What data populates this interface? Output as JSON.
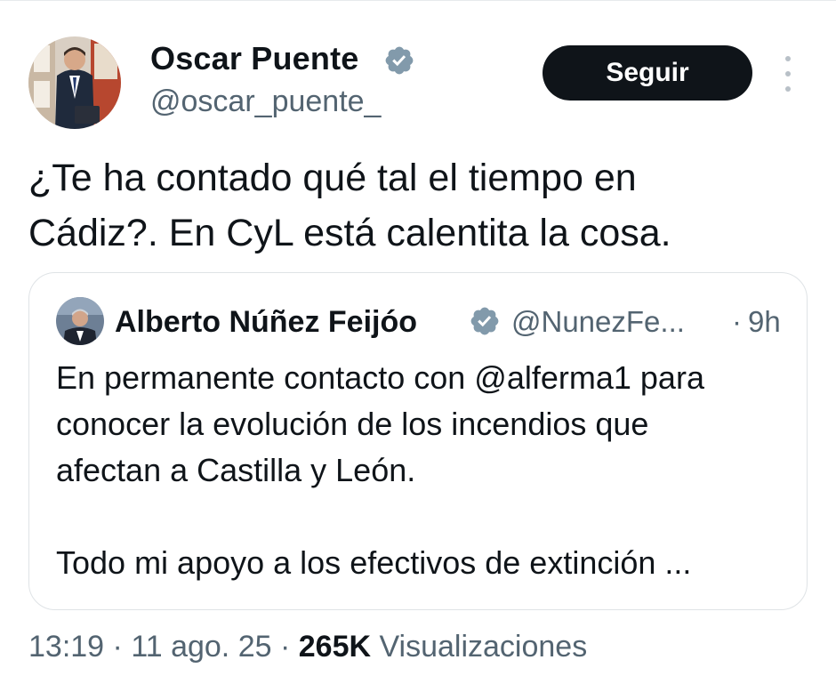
{
  "tweet": {
    "author": {
      "name": "Oscar Puente",
      "handle": "@oscar_puente_",
      "verified_icon": "verified-badge-icon"
    },
    "follow_label": "Seguir",
    "more_icon": "more-vertical-icon",
    "text": "¿Te ha contado qué tal el tiempo en\nCádiz?. En CyL está calentita la cosa.",
    "time": "13:19",
    "separator": "·",
    "date": "11 ago. 25",
    "views_count": "265K",
    "views_label": "Visualizaciones"
  },
  "quote": {
    "author_name": "Alberto Núñez Feijóo",
    "handle": "@NunezFe...",
    "separator": "·",
    "time": "9h",
    "lines": [
      "En permanente contacto con @alferma1 para",
      "conocer la evolución de los incendios que",
      "afectan a Castilla y León.",
      "",
      "Todo mi apoyo a los efectivos de extinción ..."
    ]
  },
  "colors": {
    "text_primary": "#0f1419",
    "text_secondary": "#536471",
    "button_bg": "#0f1419",
    "verified_badge": "#829aab",
    "border": "#dfe3e6"
  }
}
